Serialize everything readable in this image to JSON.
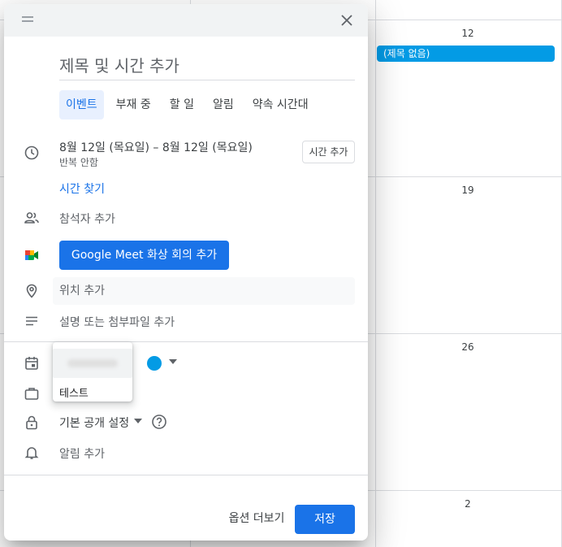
{
  "calendar": {
    "day_numbers": [
      "12",
      "19",
      "26",
      "2"
    ],
    "event_chip": "(제목 없음)",
    "event_color": "#039be5"
  },
  "dialog": {
    "title_placeholder": "제목 및 시간 추가",
    "tabs": [
      {
        "label": "이벤트",
        "active": true
      },
      {
        "label": "부재 중",
        "active": false
      },
      {
        "label": "할 일",
        "active": false
      },
      {
        "label": "알림",
        "active": false
      },
      {
        "label": "약속 시간대",
        "active": false
      }
    ],
    "date_range": "8월 12일 (목요일)  –  8월 12일 (목요일)",
    "repeat": "반복 안함",
    "add_time_label": "시간 추가",
    "find_time_label": "시간 찾기",
    "add_guests": "참석자 추가",
    "meet_button": "Google Meet 화상 회의 추가",
    "location_placeholder": "위치 추가",
    "description_placeholder": "설명 또는 첨부파일 추가",
    "calendar_option": "테스트",
    "calendar_color": "#039be5",
    "visibility": "기본 공개 설정",
    "notification": "알림 추가",
    "more_options": "옵션 더보기",
    "save": "저장",
    "accent_color": "#1a73e8",
    "icons": [
      "drag-handle-icon",
      "close-icon",
      "clock-icon",
      "people-icon",
      "google-meet-icon",
      "location-pin-icon",
      "notes-icon",
      "calendar-icon",
      "briefcase-icon",
      "lock-icon",
      "help-icon",
      "bell-icon"
    ]
  }
}
